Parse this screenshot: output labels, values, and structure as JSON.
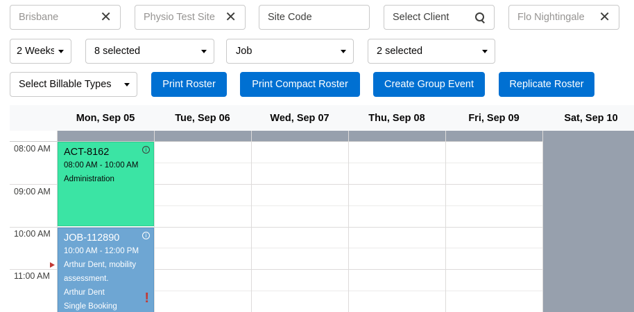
{
  "filters": {
    "location_placeholder": "Brisbane",
    "site_placeholder": "Physio Test Site",
    "site_code_placeholder": "Site Code",
    "client_placeholder": "Select Client",
    "staff_placeholder": "Flo Nightingale",
    "clear_glyph": "✕"
  },
  "dropdowns": {
    "period": "2 Weeks",
    "selection_a": "8 selected",
    "type": "Job",
    "selection_b": "2 selected",
    "billable": "Select Billable Types"
  },
  "buttons": {
    "print_roster": "Print Roster",
    "print_compact": "Print Compact Roster",
    "create_group": "Create Group Event",
    "replicate": "Replicate Roster"
  },
  "calendar": {
    "days": [
      "Mon, Sep 05",
      "Tue, Sep 06",
      "Wed, Sep 07",
      "Thu, Sep 08",
      "Fri, Sep 09",
      "Sat, Sep 10"
    ],
    "times": [
      "08:00 AM",
      "09:00 AM",
      "10:00 AM",
      "11:00 AM"
    ],
    "events": [
      {
        "title": "ACT-8162",
        "time": "08:00 AM - 10:00 AM",
        "desc": "Administration",
        "color": "#3be4a4"
      },
      {
        "title": "JOB-112890",
        "time": "10:00 AM - 12:00 PM",
        "desc1": "Arthur Dent, mobility",
        "desc2": "assessment.",
        "client": "Arthur Dent",
        "booking": "Single Booking",
        "color": "#6ea6d3"
      }
    ],
    "info_glyph": "i",
    "warning_glyph": "!"
  },
  "colors": {
    "primary": "#0070d2",
    "weekend": "#97a0ad",
    "warning": "#c23934"
  }
}
